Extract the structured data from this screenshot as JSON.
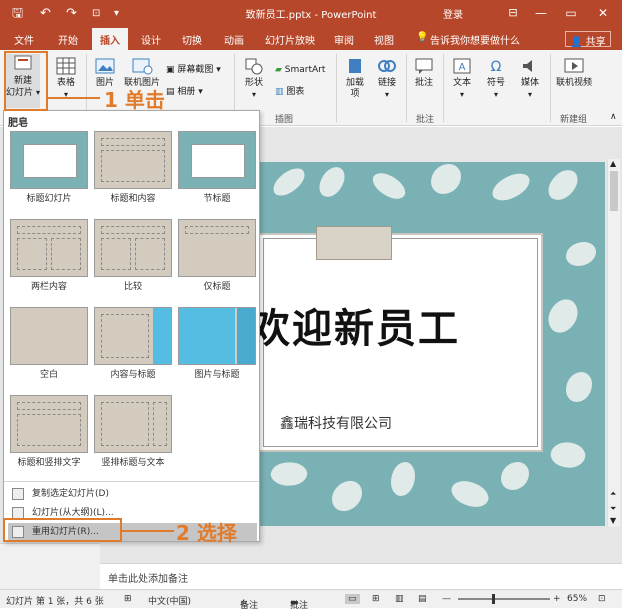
{
  "titlebar": {
    "doc_title": "致新员工.pptx - PowerPoint",
    "login": "登录",
    "qa_save": "🖫",
    "qa_undo": "↶",
    "qa_redo": "↷",
    "qa_customize": "▾",
    "minimize": "—",
    "restore": "▭",
    "close": "✕"
  },
  "tabs": [
    "文件",
    "开始",
    "插入",
    "设计",
    "切换",
    "动画",
    "幻灯片放映",
    "审阅",
    "视图"
  ],
  "active_tab": "插入",
  "tell_me": "告诉我你想要做什么",
  "share": "共享",
  "ribbon": {
    "new_slide": "新建\n幻灯片",
    "table": "表格",
    "image": "图片",
    "online_image": "联机图片",
    "screenshot": "屏幕截图",
    "album": "相册",
    "shapes": "形状",
    "smartart": "SmartArt",
    "chart": "图表",
    "addins": "加载\n项",
    "link": "链接",
    "comment": "批注",
    "text": "文本",
    "symbol": "符号",
    "media": "媒体",
    "online_video": "联机视频",
    "groups": {
      "illustrations": "插图",
      "comments": "批注",
      "new_group": "新建组"
    }
  },
  "dropdown": {
    "header": "肥皂",
    "layouts": [
      {
        "label": "标题幻灯片"
      },
      {
        "label": "标题和内容"
      },
      {
        "label": "节标题"
      },
      {
        "label": "两栏内容"
      },
      {
        "label": "比较"
      },
      {
        "label": "仅标题"
      },
      {
        "label": "空白"
      },
      {
        "label": "内容与标题"
      },
      {
        "label": "图片与标题"
      },
      {
        "label": "标题和竖排文字"
      },
      {
        "label": "竖排标题与文本"
      }
    ],
    "commands": [
      "复制选定幻灯片(D)",
      "幻灯片(从大纲)(L)...",
      "重用幻灯片(R)..."
    ]
  },
  "slide": {
    "title": "欢迎新员工",
    "subtitle": "鑫瑞科技有限公司"
  },
  "notes_placeholder": "单击此处添加备注",
  "status": {
    "slide_info": "幻灯片 第 1 张，共 6 张",
    "language": "中文(中国)",
    "notes": "备注",
    "comments": "批注",
    "zoom": "65%"
  },
  "annotations": {
    "step1": "1 单击",
    "step2": "2 选择"
  },
  "colors": {
    "accent": "#b7472a",
    "annotation": "#e07b2c",
    "slide_bg": "#7ab1b4"
  }
}
